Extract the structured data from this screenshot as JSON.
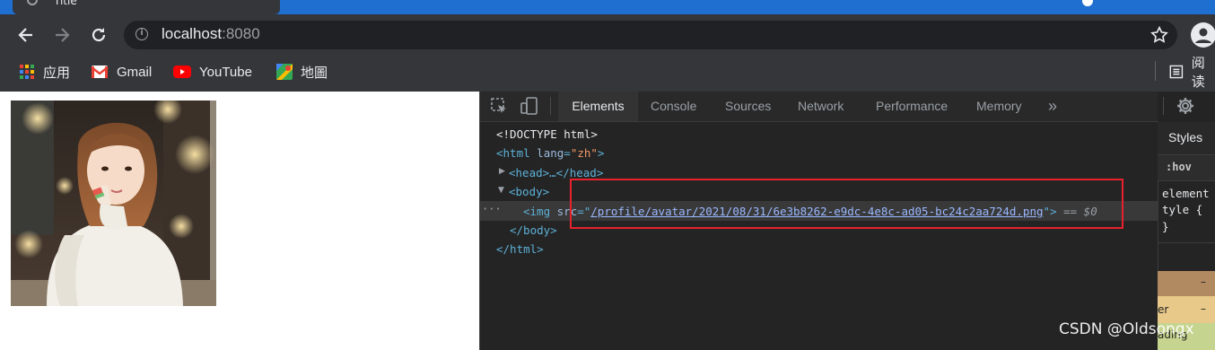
{
  "browser": {
    "tab_title": "Title",
    "url_host": "localhost",
    "url_port": ":8080",
    "bookmarks": [
      {
        "label": "应用",
        "icon": "apps-grid-icon"
      },
      {
        "label": "Gmail",
        "icon": "gmail-icon"
      },
      {
        "label": "YouTube",
        "icon": "youtube-icon"
      },
      {
        "label": "地圖",
        "icon": "maps-icon"
      }
    ],
    "reading_list_label": "阅读"
  },
  "devtools": {
    "tabs": [
      "Elements",
      "Console",
      "Sources",
      "Network",
      "Performance",
      "Memory"
    ],
    "more_tabs": "»",
    "dom": {
      "doctype": "<!DOCTYPE html>",
      "html_open": "<html",
      "html_attr": "lang",
      "html_val": "\"zh\"",
      "head": "<head>…</head>",
      "body_open": "<body>",
      "img_open": "<img",
      "img_attr": "src",
      "img_src": "/profile/avatar/2021/08/31/6e3b8262-e9dc-4e8c-ad05-bc24c2aa724d.png",
      "selected_marker": "== $0",
      "body_close": "</body>",
      "html_close": "</html>",
      "row_dots": "···"
    },
    "styles": {
      "tab": "Styles",
      "hov": ":hov",
      "rule_lines": [
        "element",
        "tyle {",
        "}"
      ],
      "box_labels": [
        "–",
        "er",
        "–",
        "ading"
      ]
    }
  },
  "watermark": "CSDN @Oldsongx"
}
